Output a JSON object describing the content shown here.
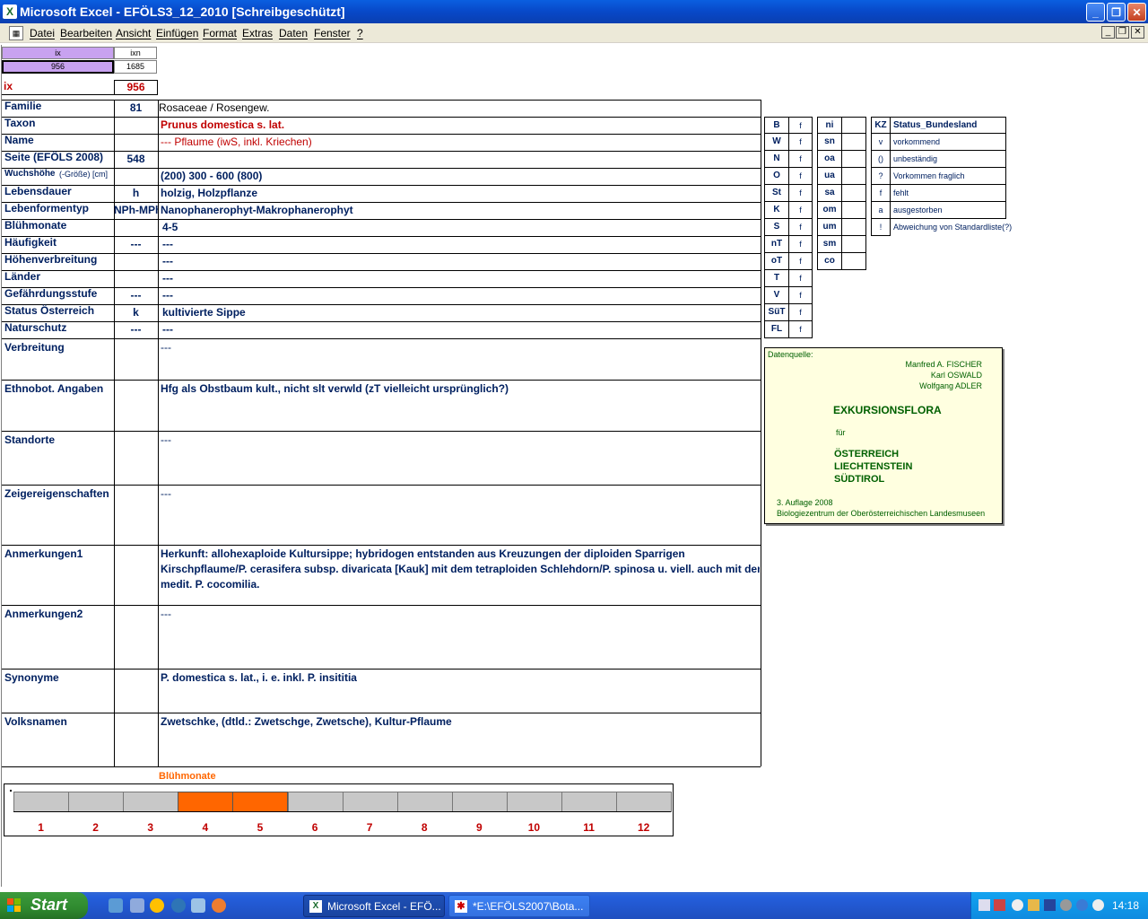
{
  "window": {
    "title": "Microsoft Excel - EFÖLS3_12_2010  [Schreibgeschützt]",
    "app_icon": "excel-icon"
  },
  "menu": [
    "Datei",
    "Bearbeiten",
    "Ansicht",
    "Einfügen",
    "Format",
    "Extras",
    "Daten",
    "Fenster",
    "?"
  ],
  "index_box": {
    "h1": "ix",
    "h2": "ixn",
    "v1": "956",
    "v2": "1685",
    "ix_label": "ix",
    "ix_value": "956"
  },
  "rows": [
    {
      "label": "Familie",
      "code": "81",
      "value": "Rosaceae  /  Rosengew."
    },
    {
      "label": "Taxon",
      "code": "",
      "value": "Prunus domestica s. lat."
    },
    {
      "label": "Name",
      "code": "",
      "value": "--- Pflaume (iwS, inkl. Kriechen)"
    },
    {
      "label": "Seite (EFÖLS 2008)",
      "code": "548",
      "value": ""
    },
    {
      "label": "Wuchshöhe",
      "label_suffix": "(-Größe) [cm]",
      "code": "",
      "value": "(200) 300 - 600 (800)"
    },
    {
      "label": "Lebensdauer",
      "code": "h",
      "value": "holzig, Holzpflanze"
    },
    {
      "label": "Lebenformentyp",
      "code": "NPh-MPh",
      "value": "Nanophanerophyt-Makrophanerophyt"
    },
    {
      "label": "Blühmonate",
      "code": "",
      "value": "4-5"
    },
    {
      "label": "Häufigkeit",
      "code": "---",
      "value": "---"
    },
    {
      "label": "Höhenverbreitung",
      "code": "",
      "value": "---"
    },
    {
      "label": "Länder",
      "code": "",
      "value": "---"
    },
    {
      "label": "Gefährdungsstufe",
      "code": "---",
      "value": "  ---"
    },
    {
      "label": "Status Österreich",
      "code": "k",
      "value": "kultivierte Sippe"
    },
    {
      "label": "Naturschutz",
      "code": "---",
      "value": "---"
    }
  ],
  "big_rows": [
    {
      "label": "Verbreitung",
      "value": "---",
      "lines": []
    },
    {
      "label": "Ethnobot. Angaben",
      "value": "Hfg als Obstbaum kult., nicht slt verwld (zT vielleicht ursprünglich?)",
      "lines": []
    },
    {
      "label": "Standorte",
      "value": "---",
      "lines": []
    },
    {
      "label": "Zeigereigenschaften",
      "value": "---",
      "lines": []
    },
    {
      "label": "Anmerkungen1",
      "value": "",
      "lines": [
        "Herkunft: allohexaploide Kultursippe; hybridogen entstanden aus Kreuzungen der diploiden Sparrigen",
        "Kirschpflaume/P. cerasifera subsp. divaricata [Kauk] mit dem tetraploiden Schlehdorn/P. spinosa u. viell. auch mit der",
        "medit. P. cocomilia."
      ]
    },
    {
      "label": "Anmerkungen2",
      "value": "---",
      "lines": []
    },
    {
      "label": "Synonyme",
      "value": "P. domestica s. lat., i. e. inkl. P. insititia",
      "lines": []
    },
    {
      "label": "Volksnamen",
      "value": "Zwetschke,  (dtld.: Zwetschge, Zwetsche), Kultur-Pflaume",
      "lines": []
    }
  ],
  "region_table": [
    {
      "k": "B",
      "v": "f"
    },
    {
      "k": "W",
      "v": "f"
    },
    {
      "k": "N",
      "v": "f"
    },
    {
      "k": "O",
      "v": "f"
    },
    {
      "k": "St",
      "v": "f"
    },
    {
      "k": "K",
      "v": "f"
    },
    {
      "k": "S",
      "v": "f"
    },
    {
      "k": "nT",
      "v": "f"
    },
    {
      "k": "oT",
      "v": "f"
    },
    {
      "k": "T",
      "v": "f"
    },
    {
      "k": "V",
      "v": "f"
    },
    {
      "k": "SüT",
      "v": "f"
    },
    {
      "k": "FL",
      "v": "f"
    }
  ],
  "zone_table": [
    {
      "k": "ni"
    },
    {
      "k": "sn"
    },
    {
      "k": "oa"
    },
    {
      "k": "ua"
    },
    {
      "k": "sa"
    },
    {
      "k": "om"
    },
    {
      "k": "um"
    },
    {
      "k": "sm"
    },
    {
      "k": "co"
    }
  ],
  "status_legend": {
    "header_kz": "KZ",
    "header_label": "Status_Bundesland",
    "items": [
      {
        "k": "v",
        "v": "vorkommend"
      },
      {
        "k": "()",
        "v": "unbeständig"
      },
      {
        "k": "?",
        "v": "Vorkommen fraglich"
      },
      {
        "k": "f",
        "v": "fehlt"
      },
      {
        "k": "a",
        "v": "ausgestorben"
      },
      {
        "k": "!",
        "v": "Abweichung von Standardliste(?)"
      }
    ]
  },
  "source": {
    "label": "Datenquelle:",
    "authors": [
      "Manfred A. FISCHER",
      "Karl OSWALD",
      "Wolfgang ADLER"
    ],
    "title": "EXKURSIONSFLORA",
    "fuer": "für",
    "countries": [
      "ÖSTERREICH",
      "LIECHTENSTEIN",
      "SÜDTIROL"
    ],
    "edition": "3. Auflage 2008",
    "publisher": "Biologiezentrum der Oberösterreichischen Landesmuseen"
  },
  "bloom": {
    "title": "Blühmonate",
    "months": [
      "1",
      "2",
      "3",
      "4",
      "5",
      "6",
      "7",
      "8",
      "9",
      "10",
      "11",
      "12"
    ],
    "active": [
      4,
      5
    ],
    "colors": {
      "on": "#ff6600",
      "off": "#c8c8c8"
    }
  },
  "taskbar": {
    "start": "Start",
    "tasks": [
      "Microsoft Excel - EFÖ...",
      "*E:\\EFÖLS2007\\Bota..."
    ],
    "clock": "14:18"
  }
}
